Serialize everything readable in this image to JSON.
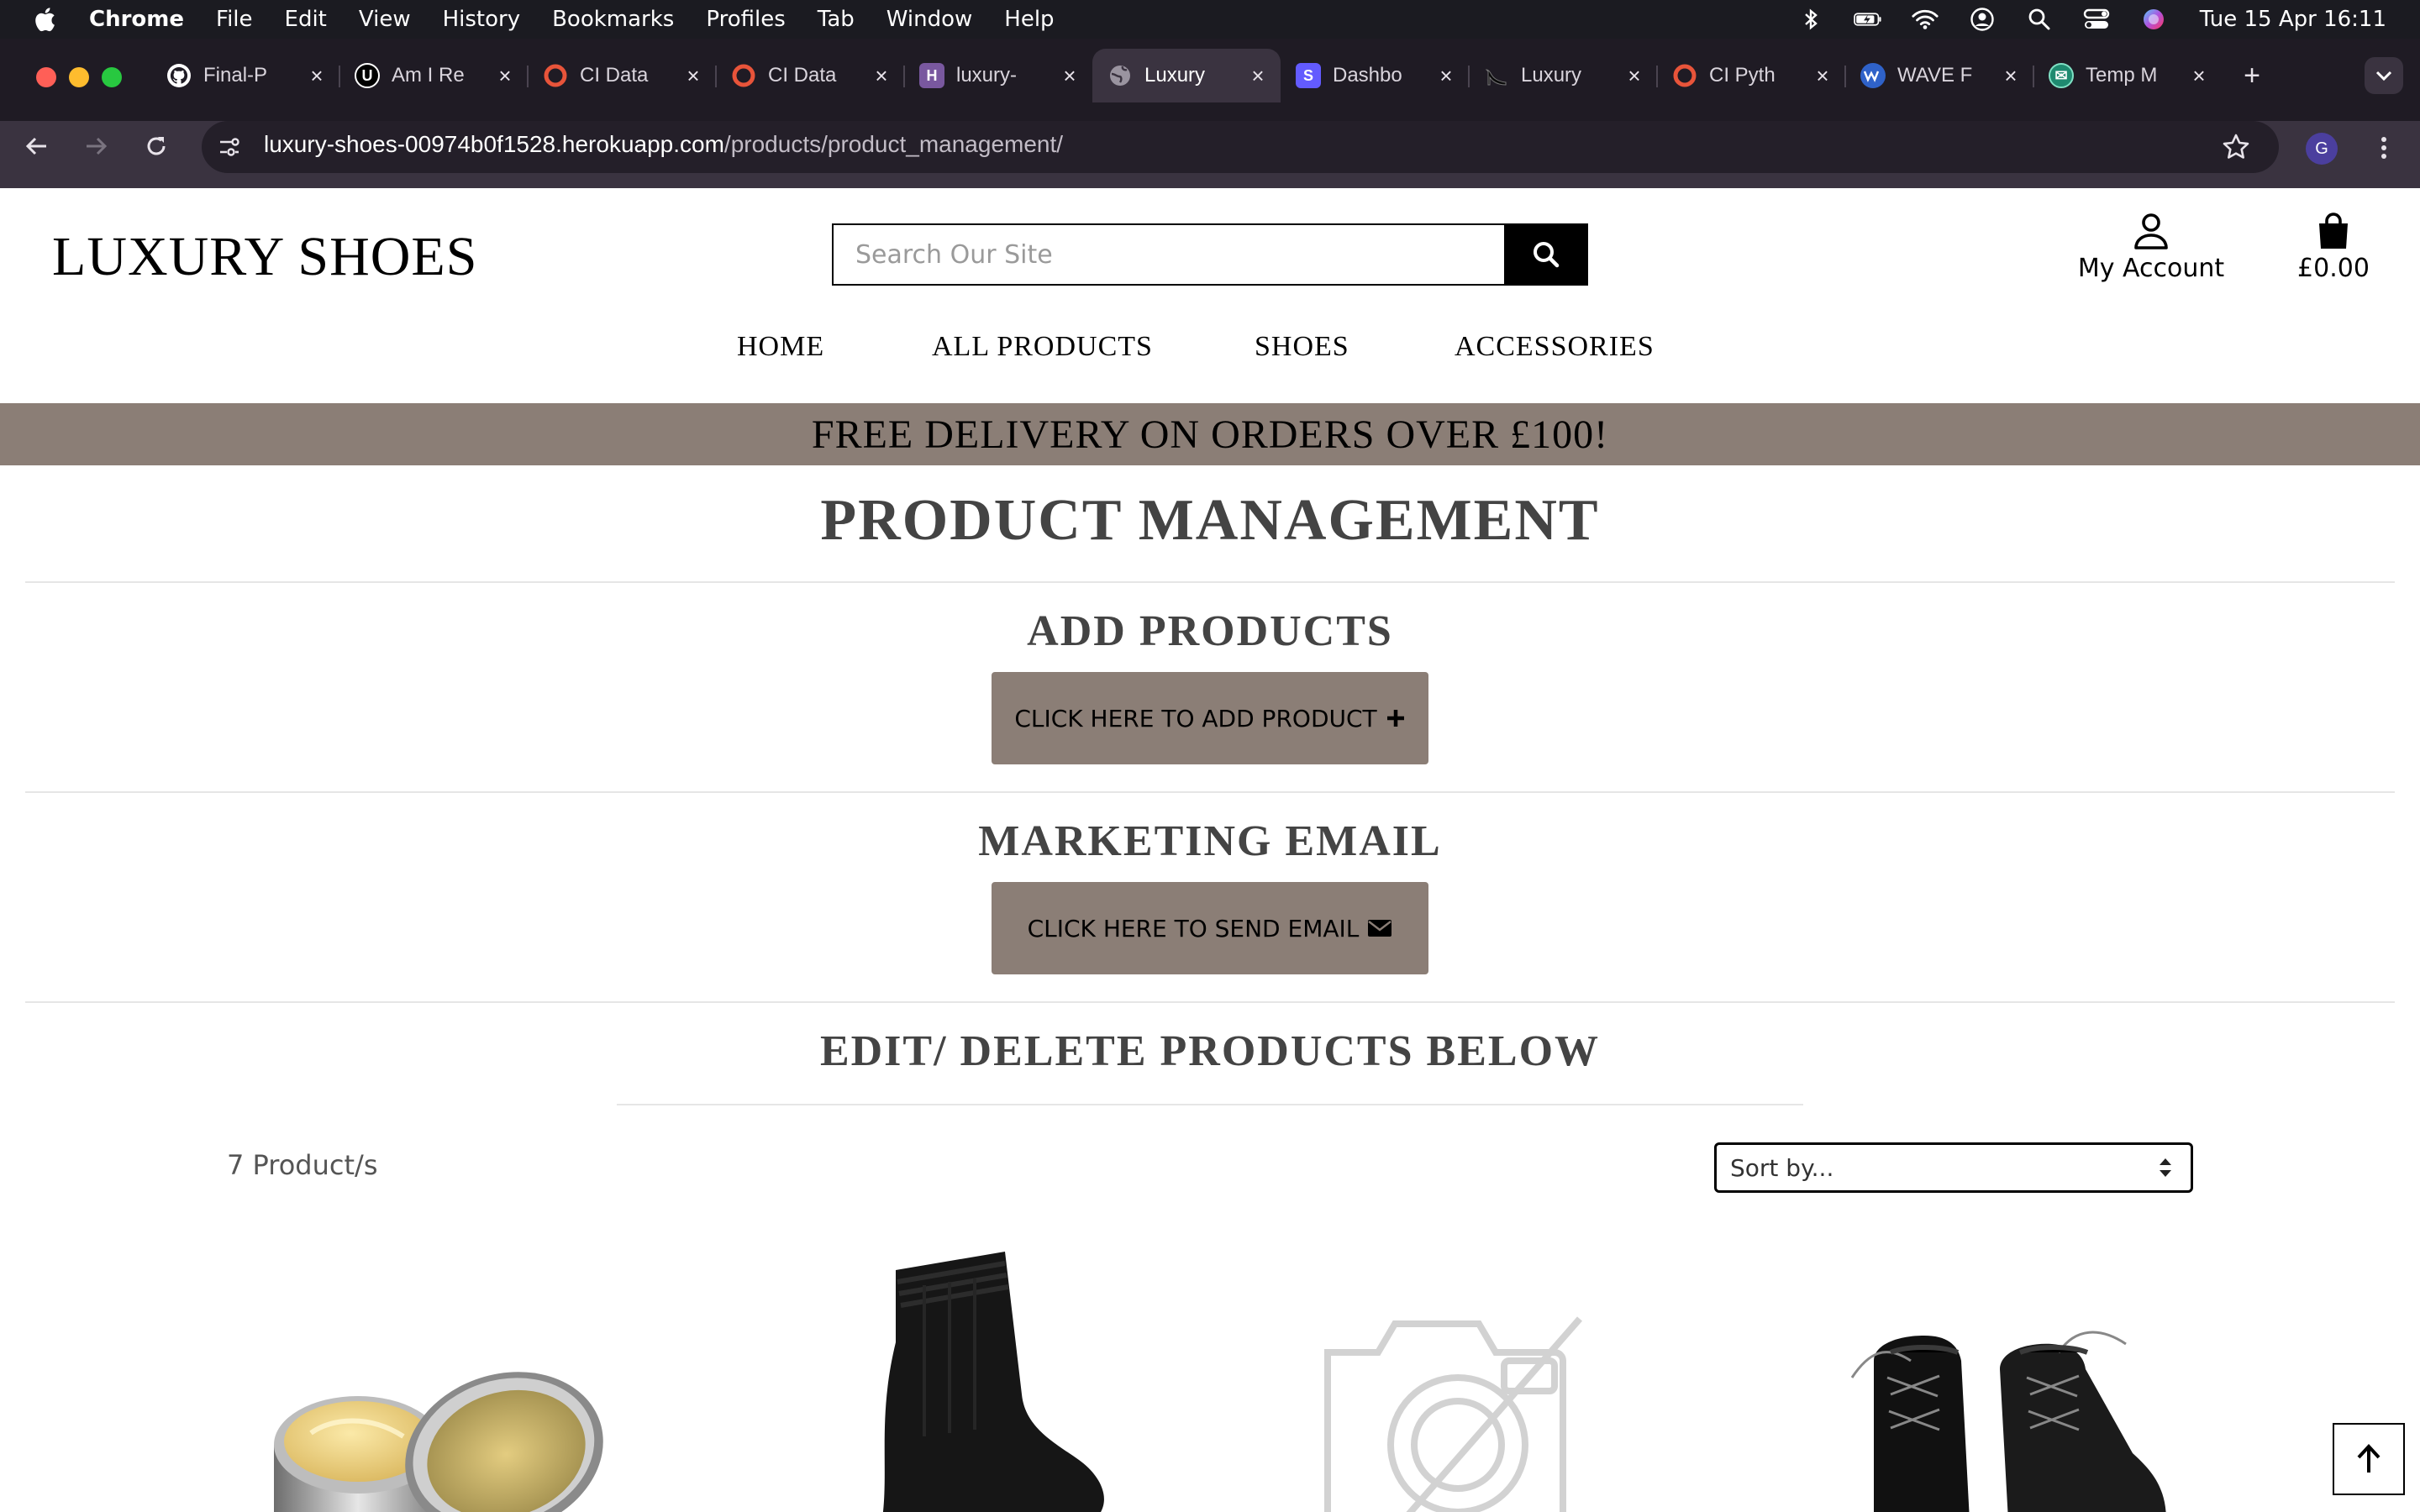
{
  "menubar": {
    "app_name": "Chrome",
    "menus": [
      "File",
      "Edit",
      "View",
      "History",
      "Bookmarks",
      "Profiles",
      "Tab",
      "Window",
      "Help"
    ],
    "clock": "Tue 15 Apr  16:11"
  },
  "browser": {
    "tabs": [
      {
        "title": "Final-P",
        "icon": "github-icon"
      },
      {
        "title": "Am I Re",
        "icon": "ui-dev-icon"
      },
      {
        "title": "CI Data",
        "icon": "ci-icon"
      },
      {
        "title": "CI Data",
        "icon": "ci-icon"
      },
      {
        "title": "luxury-",
        "icon": "heroku-icon"
      },
      {
        "title": "Luxury",
        "icon": "globe-icon"
      },
      {
        "title": "Dashbo",
        "icon": "stripe-icon"
      },
      {
        "title": "Luxury",
        "icon": "heel-icon"
      },
      {
        "title": "CI Pyth",
        "icon": "ci-icon"
      },
      {
        "title": "WAVE F",
        "icon": "wave-icon"
      },
      {
        "title": "Temp M",
        "icon": "temp-mail-icon"
      }
    ],
    "active_tab_index": 5,
    "url_host": "luxury-shoes-00974b0f1528.herokuapp.com",
    "url_path": "/products/product_management/",
    "profile_initial": "G"
  },
  "site": {
    "logo": "LUXURY SHOES",
    "search_placeholder": "Search Our Site",
    "account_label": "My Account",
    "bag_total": "£0.00",
    "nav": [
      "HOME",
      "ALL PRODUCTS",
      "SHOES",
      "ACCESSORIES"
    ],
    "banner": "FREE DELIVERY ON ORDERS OVER £100!"
  },
  "page": {
    "title": "PRODUCT MANAGEMENT",
    "add_heading": "ADD PRODUCTS",
    "add_button": "CLICK HERE TO ADD PRODUCT",
    "email_heading": "MARKETING EMAIL",
    "email_button": "CLICK HERE TO SEND EMAIL",
    "edit_heading": "EDIT/ DELETE PRODUCTS BELOW",
    "product_count": "7 Product/s",
    "sort_label": "Sort by..."
  },
  "products": [
    {
      "image": "shoe-cream-tin-image"
    },
    {
      "image": "black-sock-image"
    },
    {
      "image": "no-image-placeholder"
    },
    {
      "image": "black-boots-image"
    }
  ],
  "colors": {
    "accent_taupe": "#8b7e76",
    "menubar_bg": "#1b1b21",
    "chrome_bg": "#3a3340"
  }
}
